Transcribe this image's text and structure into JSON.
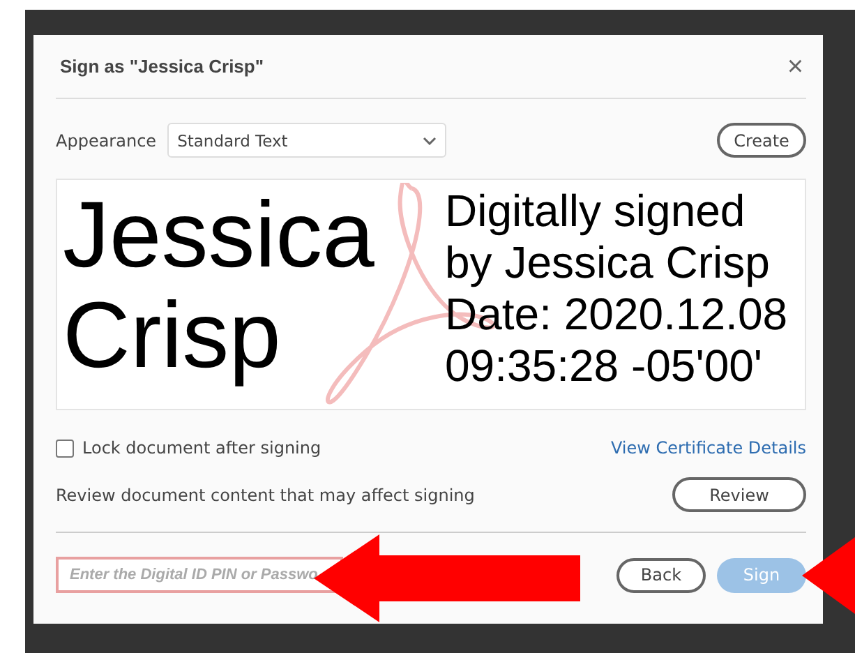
{
  "dialog": {
    "title": "Sign as \"Jessica Crisp\"",
    "close": "×"
  },
  "appearance": {
    "label": "Appearance",
    "value": "Standard Text",
    "create": "Create"
  },
  "preview": {
    "name_lines": [
      "Jessica",
      "Crisp"
    ],
    "detail_lines": [
      "Digitally signed",
      "by Jessica Crisp",
      "Date: 2020.12.08",
      "09:35:28 -05'00'"
    ]
  },
  "lock": {
    "label": "Lock document after signing",
    "checked": false
  },
  "certificate_link": "View Certificate Details",
  "review": {
    "text": "Review document content that may affect signing",
    "button": "Review"
  },
  "password": {
    "placeholder": "Enter the Digital ID PIN or Passwo"
  },
  "buttons": [
    {
      "label": "Back",
      "kind": "secondary",
      "disabled": false
    },
    {
      "label": "Sign",
      "kind": "primary",
      "disabled": true
    }
  ]
}
